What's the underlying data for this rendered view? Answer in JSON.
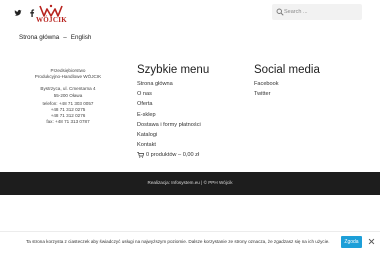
{
  "header": {
    "logo_text": "WÓJCIK",
    "search": {
      "placeholder": "Search ..."
    },
    "nav": {
      "home": "Strona główna",
      "separator": "–",
      "english": "English"
    }
  },
  "colors": {
    "brand_red": "#b8231e",
    "dark_bar": "#1d1d1d",
    "cookie_button": "#1d9fd8"
  },
  "icons": [
    "twitter-icon",
    "facebook-icon",
    "search-icon",
    "cart-icon",
    "close-icon"
  ],
  "contact": {
    "company_line1": "Przedsiębiorstwo",
    "company_line2": "Produkcyjno-Handlowe WÓJCIK",
    "street": "Bystrzyca, ul. Cmentarna 4",
    "city": "55-200 Oława",
    "phone1": "telefon: +48 71 303 0057",
    "phone2": "+48 71 312 0275",
    "phone3": "+48 71 312 0276",
    "fax": "fax: +48 71 313 0787"
  },
  "quick_menu": {
    "title": "Szybkie menu",
    "items": [
      "Strona główna",
      "O nas",
      "Oferta",
      "E-sklep",
      "Dostawa i formy płatności",
      "Katalogi",
      "Kontakt"
    ],
    "cart_text": "0 produktów – 0,00 zł"
  },
  "social_media": {
    "title": "Social media",
    "items": [
      "Facebook",
      "Twitter"
    ]
  },
  "footer": {
    "copyright": "Realizacja: Infosystem.eu | © PPH Wójcik"
  },
  "cookie": {
    "text": "Ta strona korzysta z ciasteczek aby świadczyć usługi na najwyższym poziomie. Dalsze korzystanie ze strony oznacza, że zgadzasz się na ich użycie.",
    "button": "Zgoda"
  }
}
